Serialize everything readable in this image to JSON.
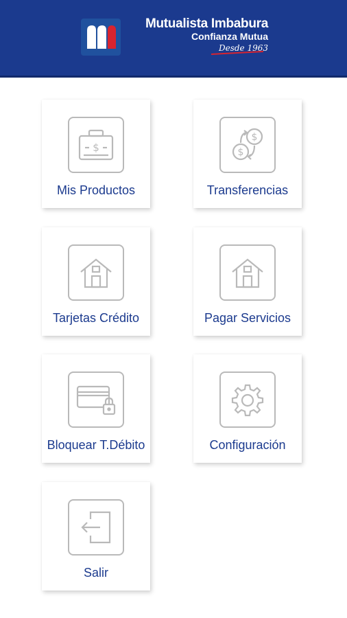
{
  "header": {
    "brand_name": "Mutualista Imbabura",
    "tagline": "Confianza Mutua",
    "since": "Desde 1963"
  },
  "colors": {
    "header_bg": "#1b3a8e",
    "label": "#1b3a8e",
    "icon_stroke": "#b9b9b9",
    "accent_red": "#d8242f"
  },
  "menu": [
    {
      "label": "Mis Productos",
      "icon": "cash-register-icon"
    },
    {
      "label": "Transferencias",
      "icon": "money-exchange-icon"
    },
    {
      "label": "Tarjetas Crédito",
      "icon": "house-icon"
    },
    {
      "label": "Pagar Servicios",
      "icon": "house-icon"
    },
    {
      "label": "Bloquear T.Débito",
      "icon": "locked-card-icon"
    },
    {
      "label": "Configuración",
      "icon": "gear-icon"
    },
    {
      "label": "Salir",
      "icon": "exit-door-icon"
    }
  ]
}
